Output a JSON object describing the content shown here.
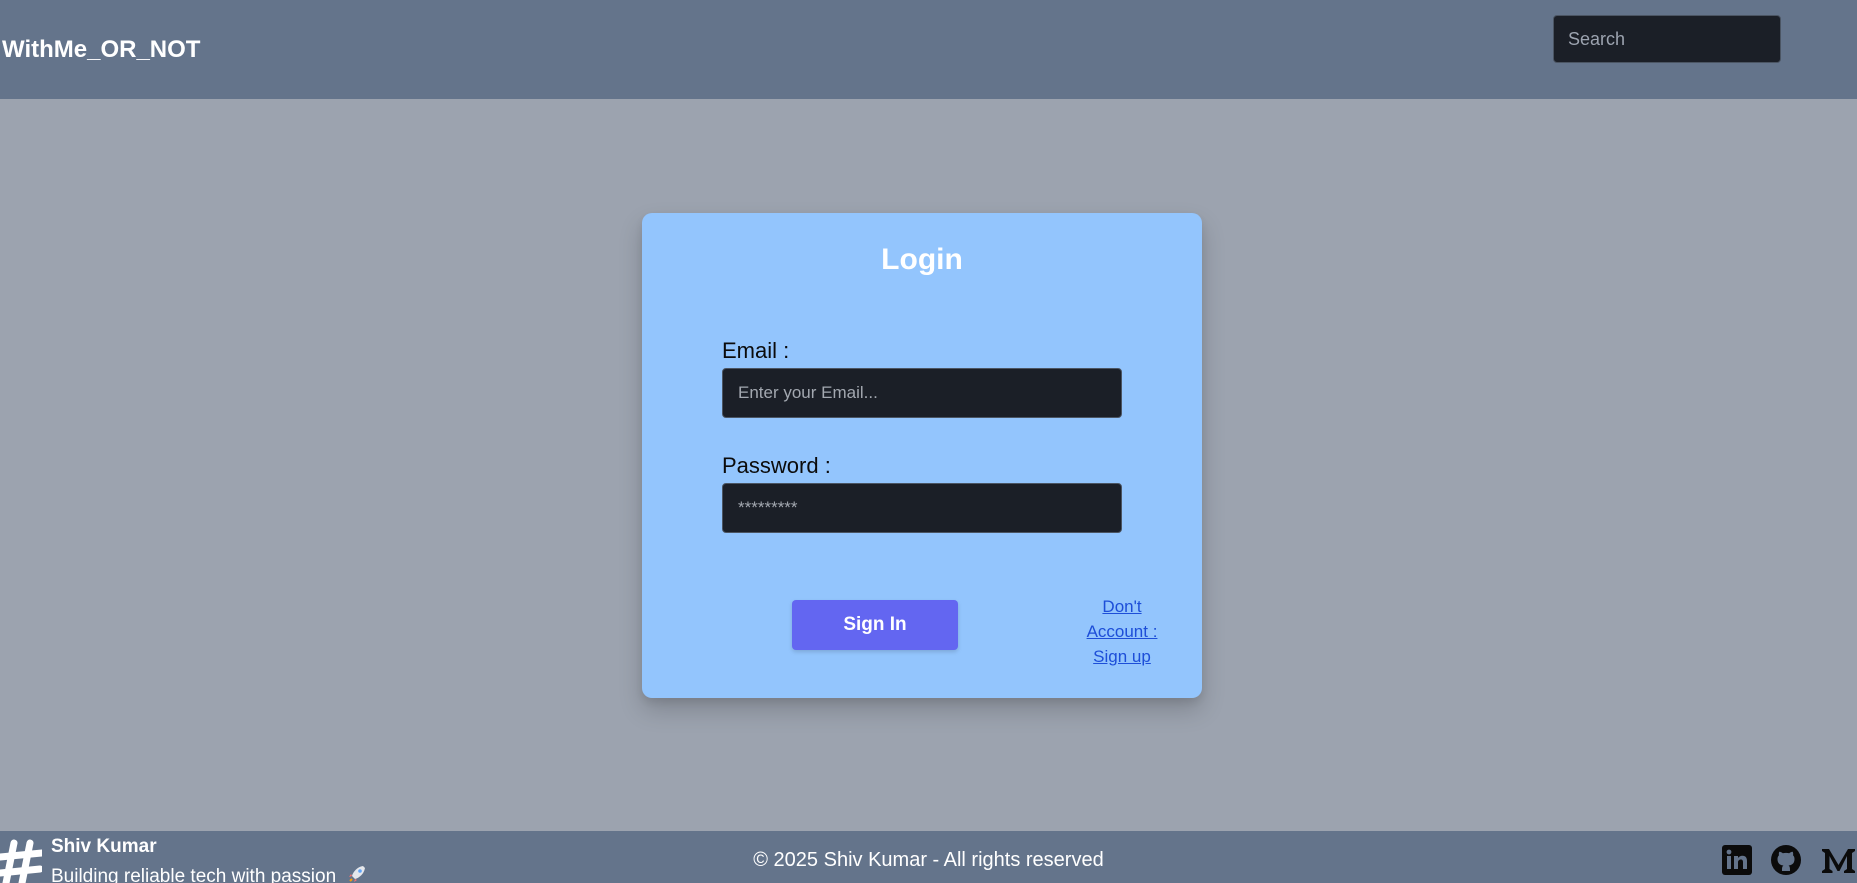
{
  "navbar": {
    "brand": "WithMe_OR_NOT",
    "search_placeholder": "Search"
  },
  "login": {
    "title": "Login",
    "email_label": "Email :",
    "email_placeholder": "Enter your Email...",
    "password_label": "Password :",
    "password_placeholder": "*********",
    "signin_label": "Sign In",
    "signup_link": "Don't Account : Sign up"
  },
  "footer": {
    "author": "Shiv Kumar",
    "tagline": "Building reliable tech with passion",
    "copyright": "© 2025 Shiv Kumar - All rights reserved",
    "icons": [
      "hashtag-logo-icon",
      "rocket-icon",
      "linkedin-icon",
      "github-icon",
      "medium-icon"
    ]
  },
  "colors": {
    "navbar_bg": "#64748b",
    "page_bg": "#9ca3af",
    "card_bg": "#93c5fd",
    "input_bg": "#1b1f27",
    "button_bg": "#6366f1",
    "link": "#1d4ed8"
  }
}
